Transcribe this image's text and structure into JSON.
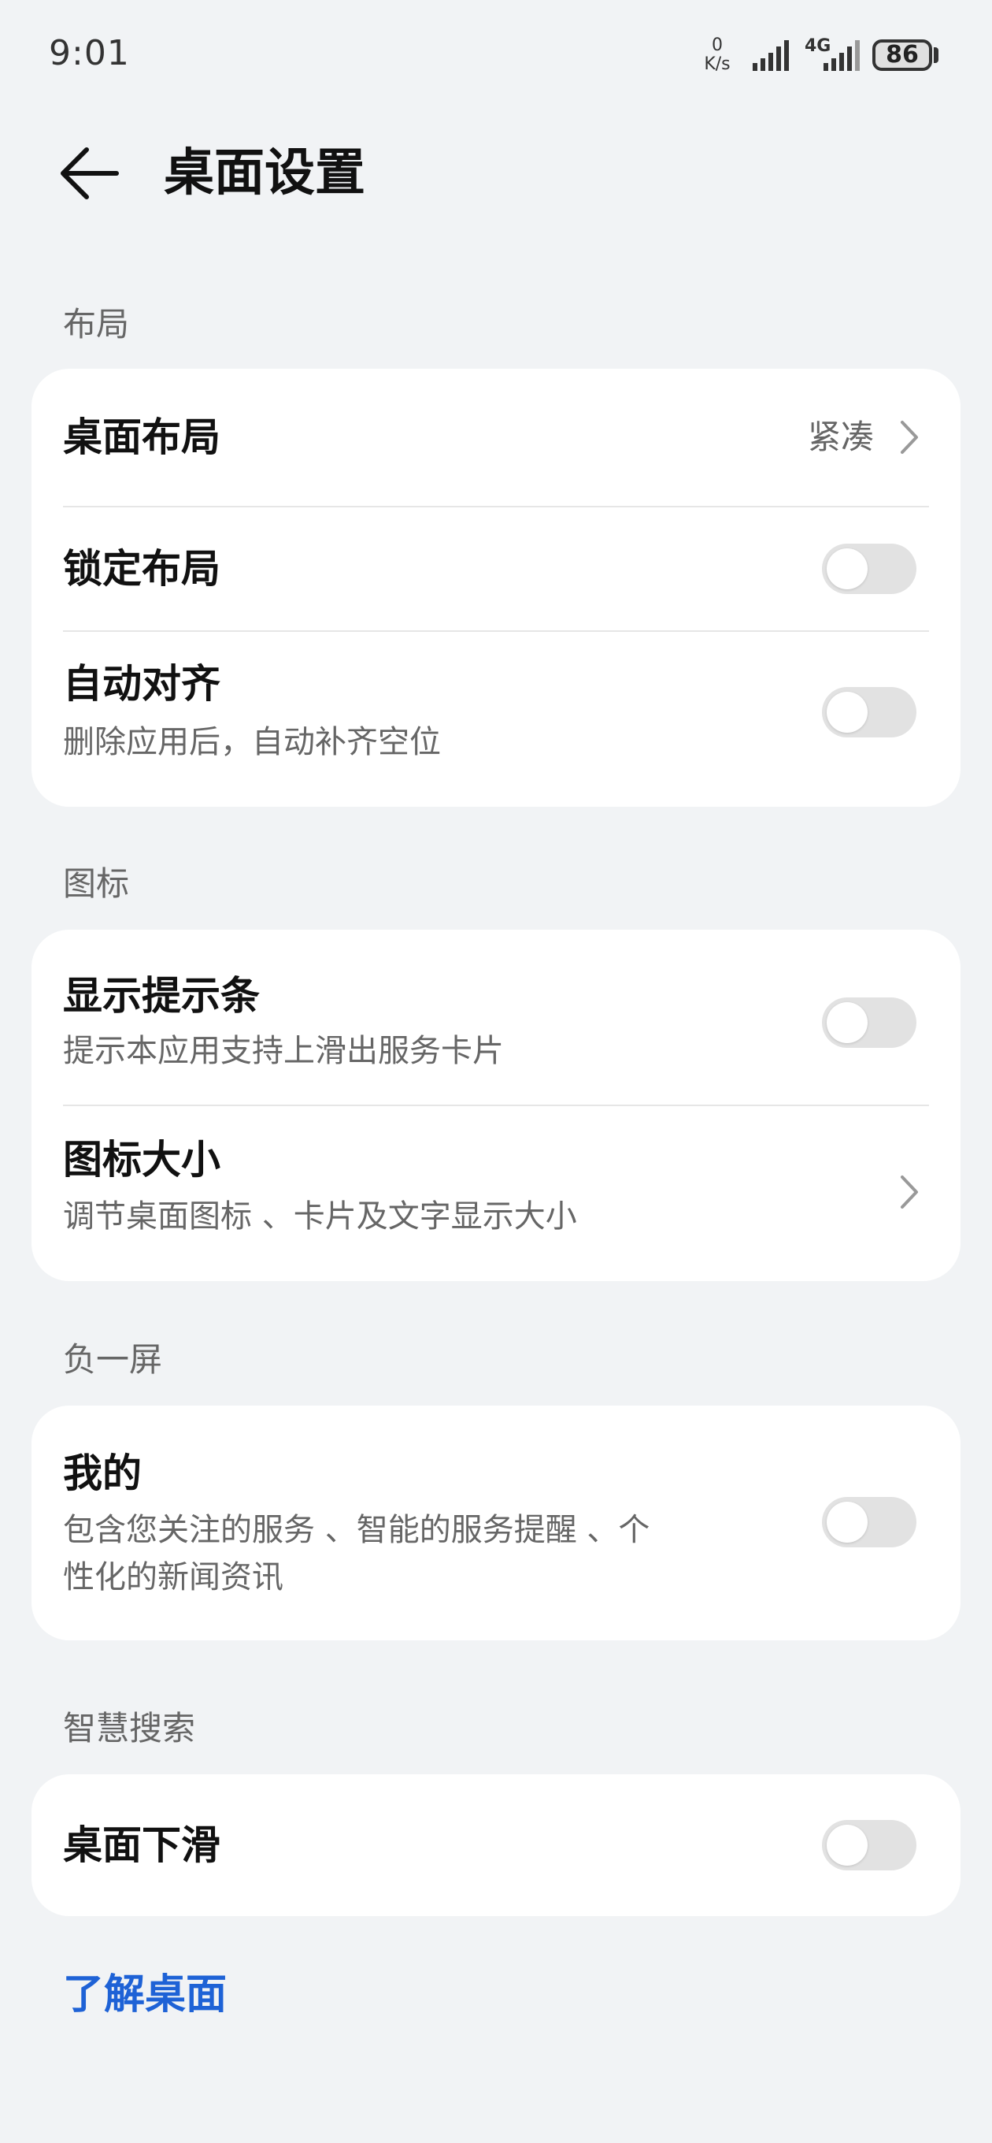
{
  "status_bar": {
    "time": "9:01",
    "net_speed_value": "0",
    "net_speed_unit": "K/s",
    "network_type": "4G",
    "battery_level": "86",
    "signal_icon": "signal-bars-icon"
  },
  "header": {
    "back_icon": "arrow-left-icon",
    "title": "桌面设置"
  },
  "sections": {
    "layout": {
      "label": "布局",
      "items": [
        {
          "title": "桌面布局",
          "value": "紧凑",
          "type": "link"
        },
        {
          "title": "锁定布局",
          "type": "toggle",
          "enabled": false
        },
        {
          "title": "自动对齐",
          "subtitle": "删除应用后，自动补齐空位",
          "type": "toggle",
          "enabled": false
        }
      ]
    },
    "icons": {
      "label": "图标",
      "items": [
        {
          "title": "显示提示条",
          "subtitle": "提示本应用支持上滑出服务卡片",
          "type": "toggle",
          "enabled": false
        },
        {
          "title": "图标大小",
          "subtitle": "调节桌面图标 、卡片及文字显示大小",
          "type": "link"
        }
      ]
    },
    "minus_one": {
      "label": "负一屏",
      "items": [
        {
          "title": "我的",
          "subtitle_line1": "包含您关注的服务 、智能的服务提醒 、个",
          "subtitle_line2": "性化的新闻资讯",
          "type": "toggle",
          "enabled": false
        }
      ]
    },
    "smart_search": {
      "label": "智慧搜索",
      "items": [
        {
          "title": "桌面下滑",
          "type": "toggle",
          "enabled": false
        }
      ]
    }
  },
  "footer": {
    "learn_link": "了解桌面"
  },
  "colors": {
    "background": "#f1f3f5",
    "card": "#ffffff",
    "link": "#1e62d6",
    "toggle_off": "#e2e2e2"
  }
}
